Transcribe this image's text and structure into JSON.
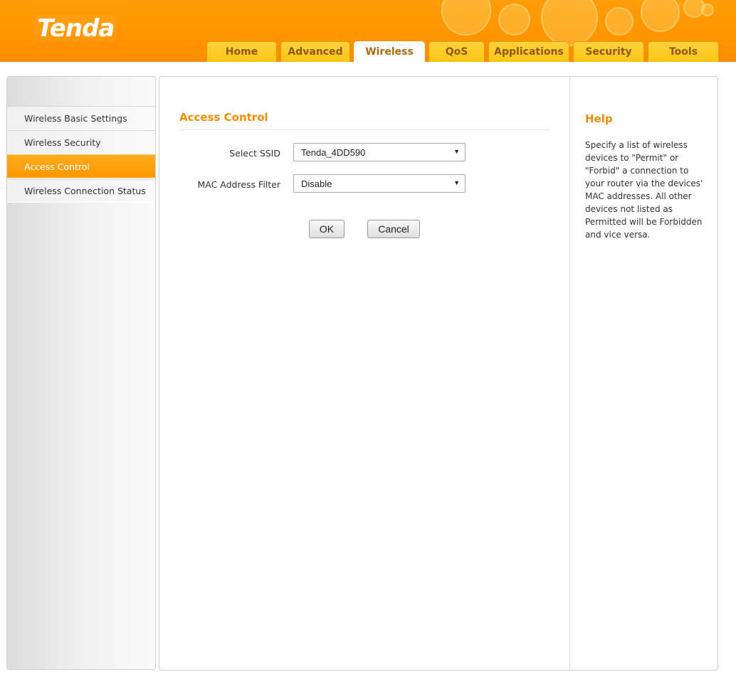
{
  "brand": {
    "logo_text": "Tenda"
  },
  "nav": {
    "tabs": [
      {
        "label": "Home",
        "active": false
      },
      {
        "label": "Advanced",
        "active": false
      },
      {
        "label": "Wireless",
        "active": true
      },
      {
        "label": "QoS",
        "active": false
      },
      {
        "label": "Applications",
        "active": false
      },
      {
        "label": "Security",
        "active": false
      },
      {
        "label": "Tools",
        "active": false
      }
    ]
  },
  "sidebar": {
    "items": [
      {
        "label": "Wireless Basic Settings",
        "active": false
      },
      {
        "label": "Wireless Security",
        "active": false
      },
      {
        "label": "Access Control",
        "active": true
      },
      {
        "label": "Wireless Connection Status",
        "active": false
      }
    ]
  },
  "main": {
    "title": "Access Control",
    "fields": {
      "ssid": {
        "label": "Select SSID",
        "value": "Tenda_4DD590"
      },
      "mac_filter": {
        "label": "MAC Address Filter",
        "value": "Disable"
      }
    },
    "buttons": {
      "ok": "OK",
      "cancel": "Cancel"
    }
  },
  "help": {
    "title": "Help",
    "text": "Specify a list of wireless devices to \"Permit\" or \"Forbid\" a connection to your router via the devices' MAC addresses. All other devices not listed as Permitted will be Forbidden and vice versa."
  },
  "colors": {
    "header_orange": "#ff9400",
    "accent_orange": "#f28c00",
    "tab_yellow": "#ffc412",
    "active_sidebar": "#ff9800"
  },
  "icons": {
    "dropdown": "triangle-down-icon"
  }
}
